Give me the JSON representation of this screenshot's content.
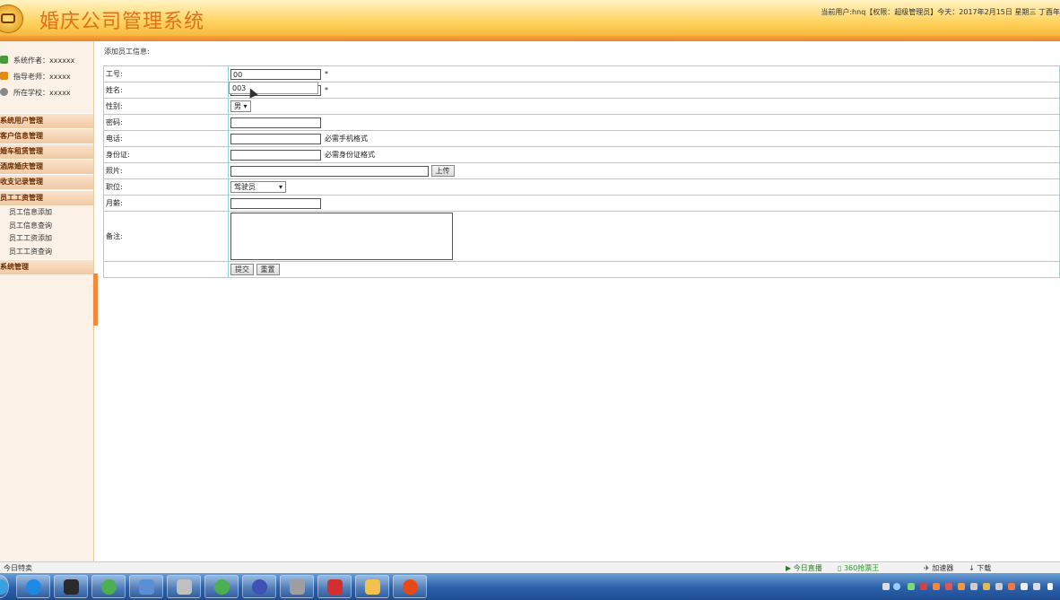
{
  "header": {
    "title": "婚庆公司管理系统",
    "user_info": "当前用户:hnq【权限：超级管理员】今天：2017年2月15日 星期三 丁酉年"
  },
  "sidebar": {
    "info": [
      {
        "label": "系统作者：xxxxxx",
        "icon": "author-icon",
        "color": "#4a9a3a"
      },
      {
        "label": "指导老师：xxxxx",
        "icon": "teacher-icon",
        "color": "#e08a1a"
      },
      {
        "label": "所在学校：xxxxx",
        "icon": "school-icon",
        "color": "#7a7a7a"
      }
    ],
    "menus": [
      {
        "label": "系统用户管理"
      },
      {
        "label": "客户信息管理"
      },
      {
        "label": "婚车租赁管理"
      },
      {
        "label": "酒席婚庆管理"
      },
      {
        "label": "收支记录管理"
      },
      {
        "label": "员工工资管理"
      }
    ],
    "submenu": [
      {
        "label": "员工信息添加"
      },
      {
        "label": "员工信息查询"
      },
      {
        "label": "员工工资添加"
      },
      {
        "label": "员工工资查询"
      }
    ],
    "last_menu": "系统管理"
  },
  "main": {
    "title": "添加员工信息:",
    "form": {
      "employee_id": {
        "label": "工号:",
        "value": "00",
        "required": "*"
      },
      "name": {
        "label": "姓名:",
        "value": "",
        "required": "*"
      },
      "gender": {
        "label": "性别:",
        "value": "男"
      },
      "password": {
        "label": "密码:",
        "value": ""
      },
      "phone": {
        "label": "电话:",
        "value": "",
        "note": "必需手机格式"
      },
      "id_card": {
        "label": "身份证:",
        "value": "",
        "note": "必需身份证格式"
      },
      "photo": {
        "label": "照片:",
        "value": "",
        "upload": "上传"
      },
      "position": {
        "label": "职位:",
        "value": "驾驶员"
      },
      "salary": {
        "label": "月薪:",
        "value": ""
      },
      "remark": {
        "label": "备注:",
        "value": ""
      },
      "submit": "提交",
      "reset": "重置"
    },
    "autocomplete_option": "003"
  },
  "statusbar": {
    "left": "今日特卖",
    "live": "今日直播",
    "tickets": "360抢票王",
    "accelerator": "加速器",
    "download": "下载"
  },
  "taskbar": {
    "apps": [
      {
        "icon": "start-orb-icon",
        "color": "#3aa0e0"
      },
      {
        "icon": "ie-icon",
        "color": "#1e88e5"
      },
      {
        "icon": "navicat-icon",
        "color": "#2a2a2a"
      },
      {
        "icon": "dreamweaver-icon",
        "color": "#4caf50"
      },
      {
        "icon": "vs-icon",
        "color": "#5b8fd4"
      },
      {
        "icon": "tools-icon",
        "color": "#c0c0c0"
      },
      {
        "icon": "chrome-icon",
        "color": "#4caf50"
      },
      {
        "icon": "eclipse-icon",
        "color": "#3f51b5"
      },
      {
        "icon": "paint-icon",
        "color": "#9e9e9e"
      },
      {
        "icon": "toolbox-icon",
        "color": "#d32f2f"
      },
      {
        "icon": "explorer-icon",
        "color": "#f2c14e"
      },
      {
        "icon": "app-icon",
        "color": "#e64a19"
      }
    ]
  }
}
